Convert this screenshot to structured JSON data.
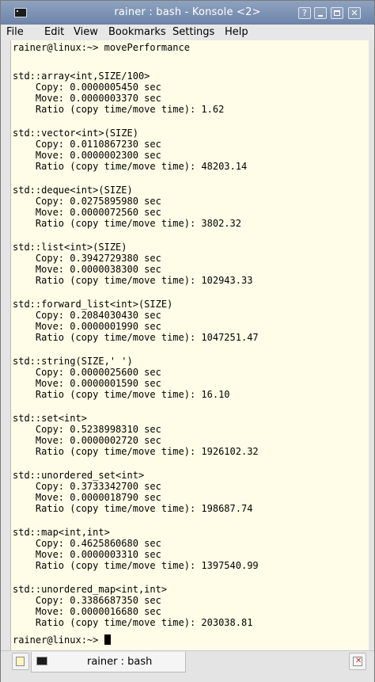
{
  "window": {
    "title": "rainer : bash - Konsole <2>",
    "buttons": {
      "help": "?",
      "minimize": "",
      "maximize": "",
      "close": "✕"
    }
  },
  "menu": [
    "File",
    "Edit",
    "View",
    "Bookmarks",
    "Settings",
    "Help"
  ],
  "terminal": {
    "lines": [
      "rainer@linux:~> movePerformance",
      "",
      "std::array<int,SIZE/100>",
      "    Copy: 0.0000005450 sec",
      "    Move: 0.0000003370 sec",
      "    Ratio (copy time/move time): 1.62",
      "",
      "std::vector<int>(SIZE)",
      "    Copy: 0.0110867230 sec",
      "    Move: 0.0000002300 sec",
      "    Ratio (copy time/move time): 48203.14",
      "",
      "std::deque<int>(SIZE)",
      "    Copy: 0.0275895980 sec",
      "    Move: 0.0000072560 sec",
      "    Ratio (copy time/move time): 3802.32",
      "",
      "std::list<int>(SIZE)",
      "    Copy: 0.3942729380 sec",
      "    Move: 0.0000038300 sec",
      "    Ratio (copy time/move time): 102943.33",
      "",
      "std::forward_list<int>(SIZE)",
      "    Copy: 0.2084030430 sec",
      "    Move: 0.0000001990 sec",
      "    Ratio (copy time/move time): 1047251.47",
      "",
      "std::string(SIZE,' ')",
      "    Copy: 0.0000025600 sec",
      "    Move: 0.0000001590 sec",
      "    Ratio (copy time/move time): 16.10",
      "",
      "std::set<int>",
      "    Copy: 0.5238998310 sec",
      "    Move: 0.0000002720 sec",
      "    Ratio (copy time/move time): 1926102.32",
      "",
      "std::unordered_set<int>",
      "    Copy: 0.3733342700 sec",
      "    Move: 0.0000018790 sec",
      "    Ratio (copy time/move time): 198687.74",
      "",
      "std::map<int,int>",
      "    Copy: 0.4625860680 sec",
      "    Move: 0.0000003310 sec",
      "    Ratio (copy time/move time): 1397540.99",
      "",
      "std::unordered_map<int,int>",
      "    Copy: 0.3386687350 sec",
      "    Move: 0.0000016680 sec",
      "    Ratio (copy time/move time): 203038.81",
      ""
    ],
    "prompt": "rainer@linux:~> "
  },
  "tabs": [
    {
      "label": "rainer : bash"
    }
  ],
  "colors": {
    "terminal_bg": "#fffde7",
    "titlebar": "#7b91b4",
    "close_tab_x": "#d02020"
  },
  "icons": {
    "app": "terminal-icon",
    "new_tab": "new-tab-icon",
    "close_tab": "close-tab-icon"
  }
}
